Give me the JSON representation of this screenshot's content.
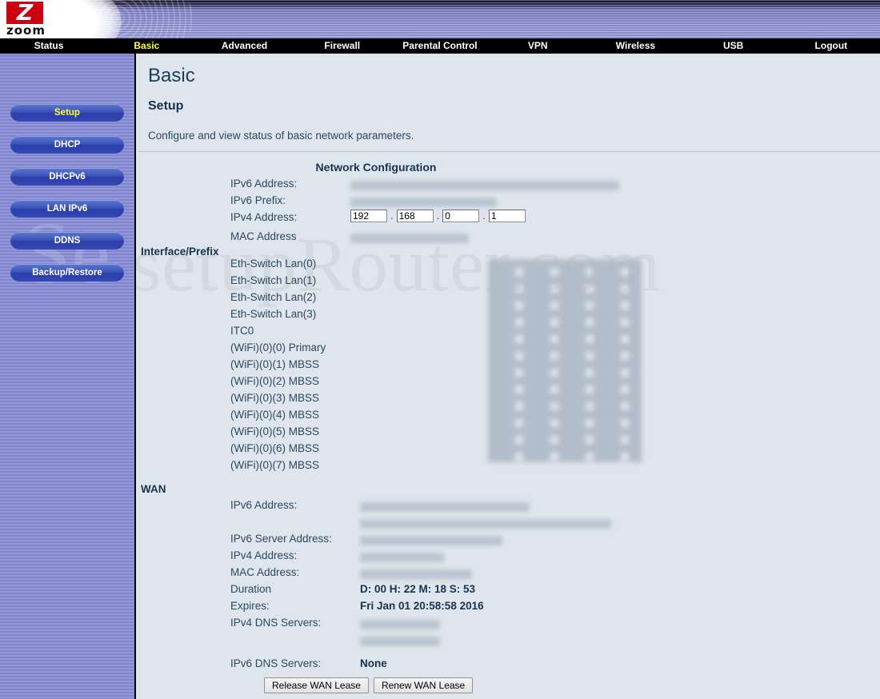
{
  "brand": {
    "logo_letter": "Z",
    "logo_word": "zoom"
  },
  "watermark": {
    "content": "setupRouter.com",
    "sidebar": "Se"
  },
  "nav": {
    "items": [
      {
        "label": "Status",
        "active": false
      },
      {
        "label": "Basic",
        "active": true
      },
      {
        "label": "Advanced",
        "active": false
      },
      {
        "label": "Firewall",
        "active": false
      },
      {
        "label": "Parental Control",
        "active": false
      },
      {
        "label": "VPN",
        "active": false
      },
      {
        "label": "Wireless",
        "active": false
      },
      {
        "label": "USB",
        "active": false
      },
      {
        "label": "Logout",
        "active": false
      }
    ]
  },
  "sidebar": {
    "items": [
      {
        "label": "Setup",
        "active": true
      },
      {
        "label": "DHCP",
        "active": false
      },
      {
        "label": "DHCPv6",
        "active": false
      },
      {
        "label": "LAN IPv6",
        "active": false
      },
      {
        "label": "DDNS",
        "active": false
      },
      {
        "label": "Backup/Restore",
        "active": false
      }
    ]
  },
  "page": {
    "title": "Basic",
    "section": "Setup",
    "description": "Configure and view status of basic network parameters."
  },
  "network_configuration": {
    "heading": "Network Configuration",
    "ipv6_address_label": "IPv6 Address:",
    "ipv6_prefix_label": "IPv6 Prefix:",
    "ipv4_address_label": "IPv4 Address:",
    "mac_address_label": "MAC Address",
    "ipv4_octets": [
      "192",
      "168",
      "0",
      "1"
    ]
  },
  "interface_prefix": {
    "heading": "Interface/Prefix",
    "rows": [
      "Eth-Switch Lan(0)",
      "Eth-Switch Lan(1)",
      "Eth-Switch Lan(2)",
      "Eth-Switch Lan(3)",
      "ITC0",
      "(WiFi)(0)(0) Primary",
      "(WiFi)(0)(1) MBSS",
      "(WiFi)(0)(2) MBSS",
      "(WiFi)(0)(3) MBSS",
      "(WiFi)(0)(4) MBSS",
      "(WiFi)(0)(5) MBSS",
      "(WiFi)(0)(6) MBSS",
      "(WiFi)(0)(7) MBSS"
    ]
  },
  "wan": {
    "heading": "WAN",
    "ipv6_address_label": "IPv6 Address:",
    "ipv6_server_address_label": "IPv6 Server Address:",
    "ipv4_address_label": "IPv4 Address:",
    "mac_address_label": "MAC Address:",
    "duration_label": "Duration",
    "duration_value": "D: 00 H: 22 M: 18 S: 53",
    "expires_label": "Expires:",
    "expires_value": "Fri Jan 01 20:58:58 2016",
    "ipv4_dns_label": "IPv4 DNS Servers:",
    "ipv6_dns_label": "IPv6 DNS Servers:",
    "ipv6_dns_value": "None"
  },
  "actions": {
    "release_label": "Release WAN Lease",
    "renew_label": "Renew WAN Lease"
  },
  "colors": {
    "header_purple": "#8f93d6",
    "nav_bg": "#000000",
    "nav_active": "#ffff33",
    "content_bg": "#dfe5ec",
    "text_dark": "#17334f",
    "logo_red": "#cc0011"
  }
}
